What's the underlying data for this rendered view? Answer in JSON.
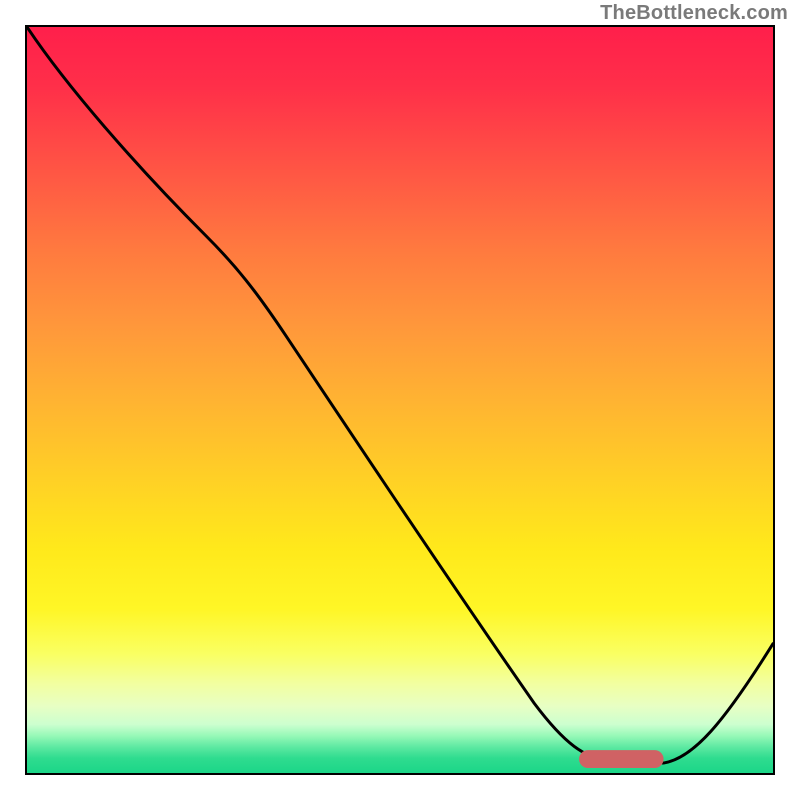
{
  "watermark": "TheBottleneck.com",
  "colors": {
    "frame_border": "#000000",
    "curve": "#000000",
    "marker": "#d06264",
    "gradient_stops": [
      "#ff1f4b",
      "#ff2f49",
      "#ff5844",
      "#ff7a3f",
      "#ff973b",
      "#ffb332",
      "#ffd424",
      "#ffe91b",
      "#fff626",
      "#faff62",
      "#f2ffa0",
      "#e8ffc3",
      "#ccffcf",
      "#97f9b8",
      "#5ee9a2",
      "#2fdc8f",
      "#1bd688"
    ]
  },
  "chart_data": {
    "type": "line",
    "title": "",
    "xlabel": "",
    "ylabel": "",
    "xlim": [
      0,
      100
    ],
    "ylim": [
      0,
      100
    ],
    "x": [
      0,
      5,
      15,
      25,
      35,
      45,
      55,
      65,
      72,
      78,
      82,
      86,
      100
    ],
    "values": [
      100,
      95,
      82,
      70,
      56,
      42,
      29,
      15,
      5,
      1,
      0,
      1,
      18
    ],
    "marker": {
      "x_start": 74,
      "x_end": 84,
      "y": 1.5
    },
    "background": "vertical-heatmap",
    "note": "y=0 is bottom (green), y=100 is top (red); curve descends from top-left, has a knee near x≈25, reaches a flat minimum around x≈78–84 where the rounded marker sits, then rises toward the right edge."
  }
}
